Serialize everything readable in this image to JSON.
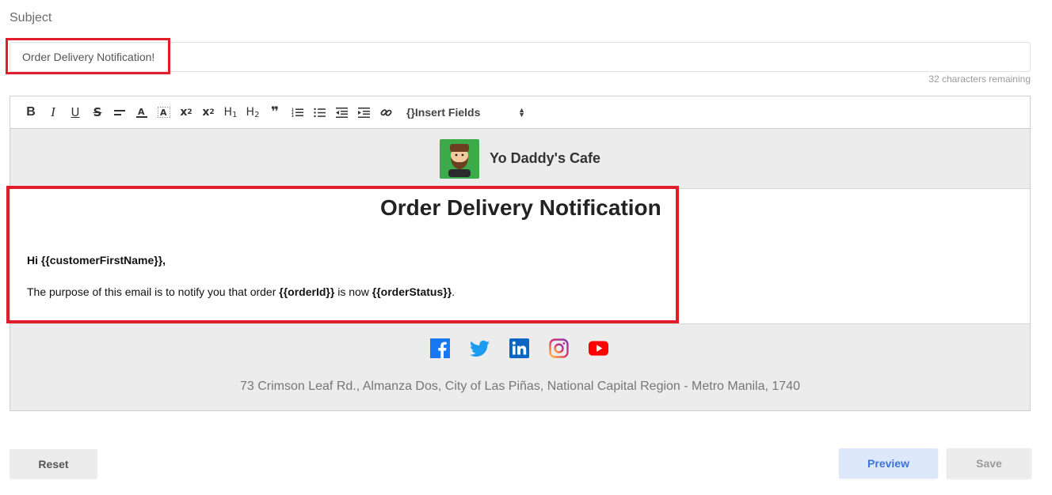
{
  "subject": {
    "label": "Subject",
    "value": "Order Delivery Notification!",
    "remaining": "32 characters remaining"
  },
  "toolbar": {
    "buttons": [
      {
        "icon": "bold-icon",
        "glyph": "B"
      },
      {
        "icon": "italic-icon",
        "glyph": "I"
      },
      {
        "icon": "underline-icon",
        "glyph": "U"
      },
      {
        "icon": "strikethrough-icon",
        "glyph": "S"
      },
      {
        "icon": "align-icon",
        "glyph": ""
      },
      {
        "icon": "text-color-icon",
        "glyph": "A"
      },
      {
        "icon": "background-color-icon",
        "glyph": "A"
      },
      {
        "icon": "superscript-icon",
        "glyph": "x²"
      },
      {
        "icon": "subscript-icon",
        "glyph": "x₂"
      },
      {
        "icon": "heading-1-icon",
        "glyph": "H1"
      },
      {
        "icon": "heading-2-icon",
        "glyph": "H2"
      },
      {
        "icon": "blockquote-icon",
        "glyph": "❞"
      },
      {
        "icon": "ordered-list-icon",
        "glyph": ""
      },
      {
        "icon": "bullet-list-icon",
        "glyph": ""
      },
      {
        "icon": "outdent-icon",
        "glyph": ""
      },
      {
        "icon": "indent-icon",
        "glyph": ""
      },
      {
        "icon": "link-icon",
        "glyph": ""
      }
    ],
    "insert_fields": "{}Insert Fields"
  },
  "email": {
    "cafe_name": "Yo Daddy's Cafe",
    "title": "Order Delivery Notification",
    "greeting": "Hi {{customerFirstName}},",
    "purpose_prefix": "The purpose of this email is to notify you that order ",
    "order_id": "{{orderId}}",
    "purpose_mid": " is now ",
    "order_status": "{{orderStatus}}",
    "purpose_suffix": ".",
    "socials": [
      "facebook-icon",
      "twitter-icon",
      "linkedin-icon",
      "instagram-icon",
      "youtube-icon"
    ],
    "address": "73 Crimson Leaf Rd., Almanza Dos, City of Las Piñas, National Capital Region - Metro Manila, 1740"
  },
  "actions": {
    "reset": "Reset",
    "preview": "Preview",
    "save": "Save"
  },
  "colors": {
    "highlight": "#e21d2b",
    "preview_bg": "#dde8fb",
    "preview_text": "#3b73d9",
    "logo_bg": "#3dab4a"
  }
}
